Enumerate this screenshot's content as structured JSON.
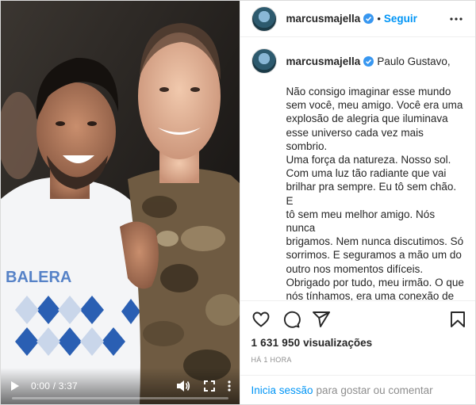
{
  "video": {
    "current_time": "0:00",
    "separator": " / ",
    "duration": "3:37",
    "progress": 0
  },
  "header": {
    "username": "marcusmajella",
    "dot": "•",
    "follow_label": "Seguir"
  },
  "caption": {
    "username": "marcusmajella",
    "greeting": "Paulo Gustavo,",
    "body": "Não consigo imaginar esse mundo\nsem você, meu amigo. Você era uma\nexplosão de alegria que iluminava\nesse universo cada vez mais sombrio.\nUma força da natureza. Nosso sol.\nCom uma luz tão radiante que vai\nbrilhar pra sempre. Eu tô sem chão. E\ntô sem meu melhor amigo. Nós nunca\nbrigamos. Nem nunca discutimos. Só\nsorrimos. E seguramos a mão um do\noutro nos momentos difíceis.\nObrigado por tudo, meu irmão. O que\nnós tínhamos, era uma conexão de\nalmas mesmo. Nunca vou esquecer\nvocê, sua generosidade e seu olhar\natento pro mundo, que você\nlindamente transformava em arte. Vai"
  },
  "stats": {
    "views_count": "1 631 950",
    "views_label": " visualizações",
    "time_ago": "HÁ 1 HORA"
  },
  "login": {
    "link": "Inicia sessão",
    "text": "para gostar ou comentar"
  },
  "colors": {
    "accent": "#0095f6",
    "verified": "#3897f0",
    "muted": "#8e8e8e"
  },
  "icons": [
    "play-icon",
    "volume-icon",
    "fullscreen-icon",
    "more-vertical-icon",
    "verified-badge-icon",
    "more-horizontal-icon",
    "heart-icon",
    "comment-icon",
    "share-icon",
    "bookmark-icon"
  ]
}
